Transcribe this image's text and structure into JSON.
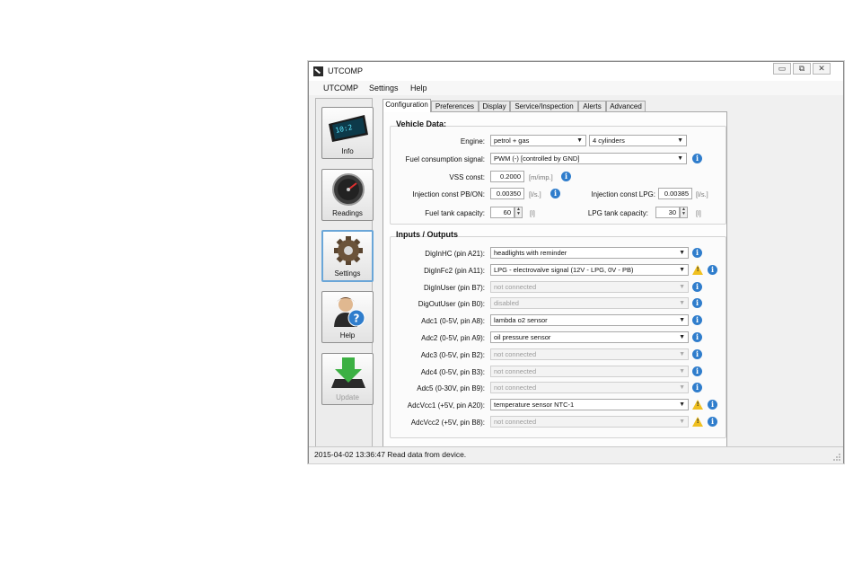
{
  "window": {
    "title": "UTCOMP",
    "minimize": "▭",
    "maximize": "⧉",
    "close": "✕"
  },
  "menu": [
    "UTCOMP",
    "Settings",
    "Help"
  ],
  "sidebar": [
    {
      "label": "Info",
      "icon": "display-icon"
    },
    {
      "label": "Readings",
      "icon": "gauge-icon"
    },
    {
      "label": "Settings",
      "icon": "gear-icon",
      "active": true
    },
    {
      "label": "Help",
      "icon": "help-person-icon"
    },
    {
      "label": "Update",
      "icon": "download-arrow-icon",
      "disabled": true
    }
  ],
  "tabs": [
    "Configuration",
    "Preferences",
    "Display",
    "Service/Inspection",
    "Alerts",
    "Advanced"
  ],
  "vehicle": {
    "title": "Vehicle Data:",
    "engine_label": "Engine:",
    "engine_value": "petrol + gas",
    "cylinders_value": "4 cylinders",
    "fuel_signal_label": "Fuel consumption signal:",
    "fuel_signal_value": "PWM (-) [controlled by GND]",
    "vss_label": "VSS const:",
    "vss_value": "0.2000",
    "vss_unit": "[m/imp.]",
    "inj_pb_label": "Injection const PB/ON:",
    "inj_pb_value": "0.00350",
    "inj_pb_unit": "[l/s.]",
    "inj_lpg_label": "Injection const LPG:",
    "inj_lpg_value": "0.00385",
    "inj_lpg_unit": "[l/s.]",
    "fuel_tank_label": "Fuel tank capacity:",
    "fuel_tank_value": "60",
    "fuel_tank_unit": "[l]",
    "lpg_tank_label": "LPG tank capacity:",
    "lpg_tank_value": "30",
    "lpg_tank_unit": "[l]"
  },
  "io": {
    "title": "Inputs / Outputs",
    "rows": [
      {
        "label": "DigInHC (pin A21):",
        "value": "headlights with reminder",
        "disabled": false,
        "warn": false
      },
      {
        "label": "DigInFc2 (pin A11):",
        "value": "LPG - electrovalve signal (12V - LPG, 0V - PB)",
        "disabled": false,
        "warn": true
      },
      {
        "label": "DigInUser (pin B7):",
        "value": "not connected",
        "disabled": true,
        "warn": false
      },
      {
        "label": "DigOutUser (pin B0):",
        "value": "disabled",
        "disabled": true,
        "warn": false
      },
      {
        "label": "Adc1 (0-5V, pin A8):",
        "value": "lambda o2 sensor",
        "disabled": false,
        "warn": false
      },
      {
        "label": "Adc2 (0-5V, pin A9):",
        "value": "oil pressure sensor",
        "disabled": false,
        "warn": false
      },
      {
        "label": "Adc3 (0-5V, pin B2):",
        "value": "not connected",
        "disabled": true,
        "warn": false
      },
      {
        "label": "Adc4 (0-5V, pin B3):",
        "value": "not connected",
        "disabled": true,
        "warn": false
      },
      {
        "label": "Adc5 (0-30V, pin B9):",
        "value": "not connected",
        "disabled": true,
        "warn": false
      },
      {
        "label": "AdcVcc1 (+5V, pin A20):",
        "value": "temperature sensor NTC-1",
        "disabled": false,
        "warn": true
      },
      {
        "label": "AdcVcc2 (+5V, pin B8):",
        "value": "not connected",
        "disabled": true,
        "warn": true
      }
    ]
  },
  "status": {
    "text": "2015-04-02 13:36:47  Read data from device."
  }
}
